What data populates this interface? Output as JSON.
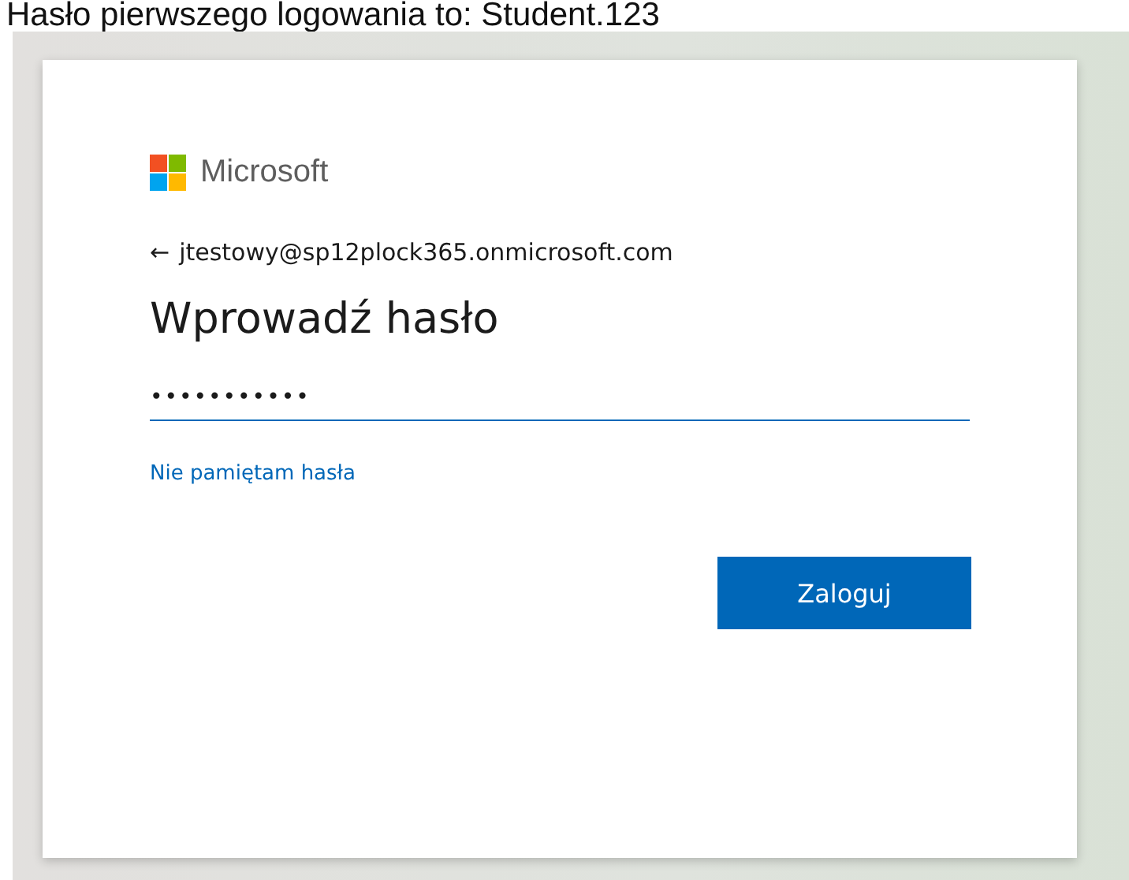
{
  "caption": "Hasło pierwszego logowania to: Student.123",
  "card": {
    "brand": "Microsoft",
    "back_arrow": "←",
    "account": "jtestowy@sp12plock365.onmicrosoft.com",
    "title": "Wprowadź hasło",
    "password": {
      "value": "•••••••••••"
    },
    "forgot_link": "Nie pamiętam hasła",
    "submit_button": "Zaloguj"
  }
}
